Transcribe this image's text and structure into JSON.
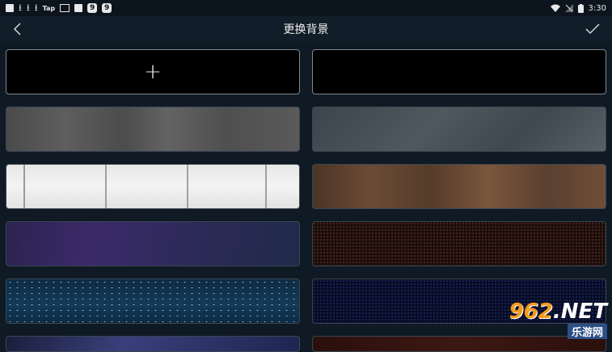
{
  "statusbar": {
    "left_icons": [
      "square-icon",
      "download-icon",
      "download-icon",
      "download-icon",
      "tap-text",
      "image-icon",
      "square-icon",
      "nine-icon",
      "nine-icon"
    ],
    "tap_text": "Tap",
    "nine": "9",
    "time": "3:30",
    "wifi": "wifi-icon",
    "signal": "signal-off-icon",
    "battery": "battery-icon"
  },
  "header": {
    "title": "更换背景",
    "back_icon": "chevron-left-icon",
    "confirm_icon": "check-icon"
  },
  "tiles": {
    "add_label": "+",
    "items": [
      "add-new",
      "black",
      "grey-wood",
      "slate-stone",
      "white-wood",
      "brown-wood",
      "purple-gradient",
      "red-dot-mesh",
      "starry-sky",
      "blue-dot-mesh",
      "blue-rays",
      "dark-red"
    ]
  },
  "watermark": {
    "big_text_num": "962",
    "big_text_suffix": ".NET",
    "small_text": "乐游网"
  }
}
